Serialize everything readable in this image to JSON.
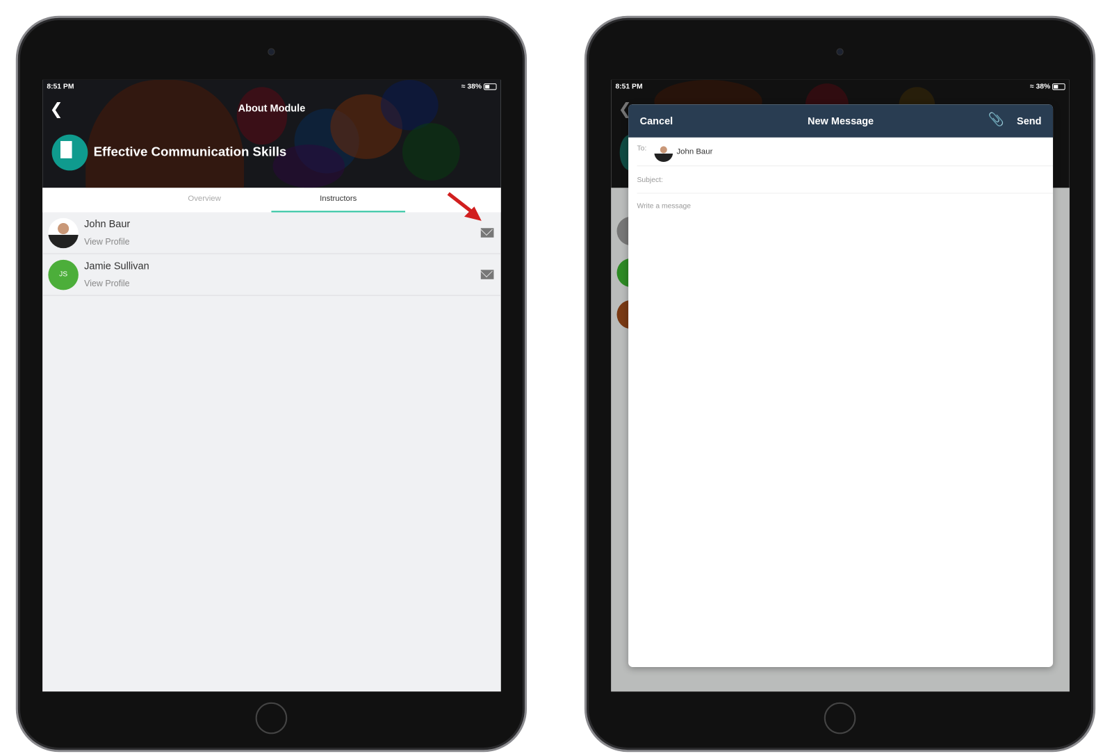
{
  "left": {
    "status": {
      "time": "8:51 PM",
      "battery": "38%"
    },
    "header": {
      "title": "About Module",
      "module_title": "Effective Communication Skills"
    },
    "tabs": [
      {
        "label": "Overview",
        "active": false
      },
      {
        "label": "Instructors",
        "active": true
      }
    ],
    "instructors": [
      {
        "name": "John Baur",
        "link": "View Profile",
        "initials": ""
      },
      {
        "name": "Jamie Sullivan",
        "link": "View Profile",
        "initials": "JS"
      }
    ]
  },
  "right": {
    "status": {
      "time": "8:51 PM",
      "battery": "38%"
    },
    "modal": {
      "cancel": "Cancel",
      "title": "New Message",
      "send": "Send",
      "to_label": "To:",
      "recipient": "John Baur",
      "subject_placeholder": "Subject:",
      "message_placeholder": "Write a message"
    }
  },
  "colors": {
    "tab_accent": "#2ec4a0",
    "modal_header": "#293d52",
    "js_avatar": "#4cae3a",
    "arrow": "#d11f1f"
  }
}
